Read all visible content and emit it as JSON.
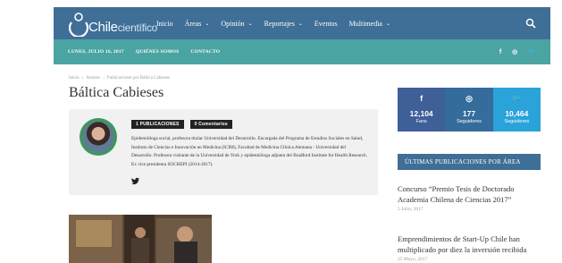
{
  "site": {
    "logo_text": "Chile",
    "logo_sub": "científico"
  },
  "nav": {
    "items": [
      {
        "label": "Inicio",
        "dropdown": false
      },
      {
        "label": "Áreas",
        "dropdown": true
      },
      {
        "label": "Opinión",
        "dropdown": true
      },
      {
        "label": "Reportajes",
        "dropdown": true
      },
      {
        "label": "Eventos",
        "dropdown": false
      },
      {
        "label": "Multimedia",
        "dropdown": true
      }
    ],
    "search_icon": "search-icon"
  },
  "subnav": {
    "date": "LUNES, JULIO 16, 2017",
    "quienes": "QUIÉNES SOMOS",
    "contacto": "CONTACTO",
    "social": [
      "f",
      "◎",
      "🐦"
    ]
  },
  "breadcrumb": {
    "home": "Inicio",
    "autores": "Autores",
    "current": "Publicaciones por Báltica Cabieses"
  },
  "page_title": "Báltica Cabieses",
  "author": {
    "posts_badge": "1 PUBLICACIONES",
    "comments_badge": "0 Comentarios",
    "bio": "Epidemióloga social, profesora titular Universidad del Desarrollo. Encargada del Programa de Estudios Sociales en Salud, Instituto de Ciencias e Innovación en Medicina (ICIM), Facultad de Medicina Clínica Alemana - Universidad del Desarrollo. Profesora visitante de la Universidad de York y epidemióloga adjunta del Bradford Institute for Health Research. Ex vice presidenta SOCHEPI (2014-2017).",
    "social_icon": "twitter-icon"
  },
  "stats": [
    {
      "icon": "f",
      "count": "12,104",
      "label": "Fans",
      "color": "#3e5f98"
    },
    {
      "icon": "◎",
      "count": "177",
      "label": "Seguidores",
      "color": "#346c9c"
    },
    {
      "icon": "🐦",
      "count": "10,464",
      "label": "Seguidores",
      "color": "#29a3d9"
    }
  ],
  "sidebar": {
    "section_title": "ÚLTIMAS PUBLICACIONES POR ÁREA",
    "posts": [
      {
        "title": "Concurso “Premio Tesis de Doctorado Academia Chilena de Ciencias 2017”",
        "date": "5 Julio, 2017"
      },
      {
        "title": "Emprendimientos de Start-Up Chile han multiplicado por diez la inversión recibida",
        "date": "25 Mayo, 2017"
      }
    ]
  },
  "colors": {
    "nav": "#3f6e96",
    "subnav": "#4aa4a2",
    "accent": "#3a9a58"
  }
}
